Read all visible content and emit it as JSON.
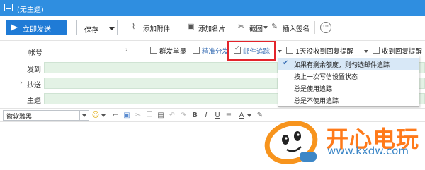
{
  "window": {
    "title": "(无主题)"
  },
  "toolbar": {
    "send_label": "立即发送",
    "save_label": "保存",
    "attach_label": "添加附件",
    "card_label": "添加名片",
    "screenshot_label": "截图",
    "signature_label": "插入签名",
    "more_symbol": "···"
  },
  "header": {
    "account_label": "帐号",
    "recipients_label": "发到",
    "cc_label": "抄送",
    "subject_label": "主题",
    "options": [
      {
        "label": "群发单显",
        "checked": false
      },
      {
        "label": "精准分发",
        "checked": false
      },
      {
        "label": "邮件追踪",
        "checked": true
      },
      {
        "label": "1天没收到回复提醒",
        "checked": false
      },
      {
        "label": "收到回复提醒",
        "checked": false
      }
    ]
  },
  "tracking_menu": {
    "items": [
      {
        "label": "如果有剩余额度，则勾选邮件追踪",
        "selected": true
      },
      {
        "label": "按上一次写信设置状态",
        "selected": false
      },
      {
        "label": "总是使用追踪",
        "selected": false
      },
      {
        "label": "总是不使用追踪",
        "selected": false
      }
    ]
  },
  "format": {
    "font_name": "微软雅黑"
  },
  "watermark": {
    "brand": "开心电玩",
    "url": "www.kxdw.com"
  },
  "colors": {
    "titlebar": "#2f8ee0",
    "send_button": "#1f7bd6",
    "field_bg": "#e3f2e5",
    "highlight": "#e3242b",
    "link_blue": "#3a6fb5"
  }
}
